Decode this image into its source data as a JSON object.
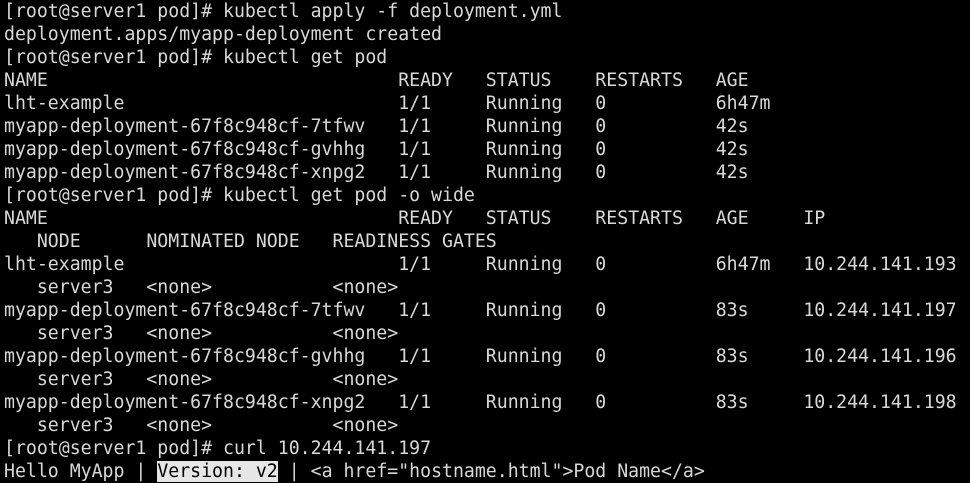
{
  "terminal": {
    "lines": [
      "[root@server1 pod]# kubectl apply -f deployment.yml",
      "deployment.apps/myapp-deployment created",
      "[root@server1 pod]# kubectl get pod",
      "NAME                                READY   STATUS    RESTARTS   AGE",
      "lht-example                         1/1     Running   0          6h47m",
      "myapp-deployment-67f8c948cf-7tfwv   1/1     Running   0          42s",
      "myapp-deployment-67f8c948cf-gvhhg   1/1     Running   0          42s",
      "myapp-deployment-67f8c948cf-xnpg2   1/1     Running   0          42s",
      "[root@server1 pod]# kubectl get pod -o wide",
      "NAME                                READY   STATUS    RESTARTS   AGE     IP",
      "   NODE      NOMINATED NODE   READINESS GATES",
      "lht-example                         1/1     Running   0          6h47m   10.244.141.193",
      "   server3   <none>           <none>",
      "myapp-deployment-67f8c948cf-7tfwv   1/1     Running   0          83s     10.244.141.197",
      "   server3   <none>           <none>",
      "myapp-deployment-67f8c948cf-gvhhg   1/1     Running   0          83s     10.244.141.196",
      "   server3   <none>           <none>",
      "myapp-deployment-67f8c948cf-xnpg2   1/1     Running   0          83s     10.244.141.198",
      "   server3   <none>           <none>",
      "[root@server1 pod]# curl 10.244.141.197"
    ],
    "last_line": {
      "before": "Hello MyApp | ",
      "selected": "Version: v2",
      "after": " | <a href=\"hostname.html\">Pod Name</a>"
    }
  },
  "colors": {
    "background": "#000000",
    "foreground": "#d8d8d8",
    "selection_bg": "#e6e6e6",
    "selection_fg": "#000000"
  }
}
